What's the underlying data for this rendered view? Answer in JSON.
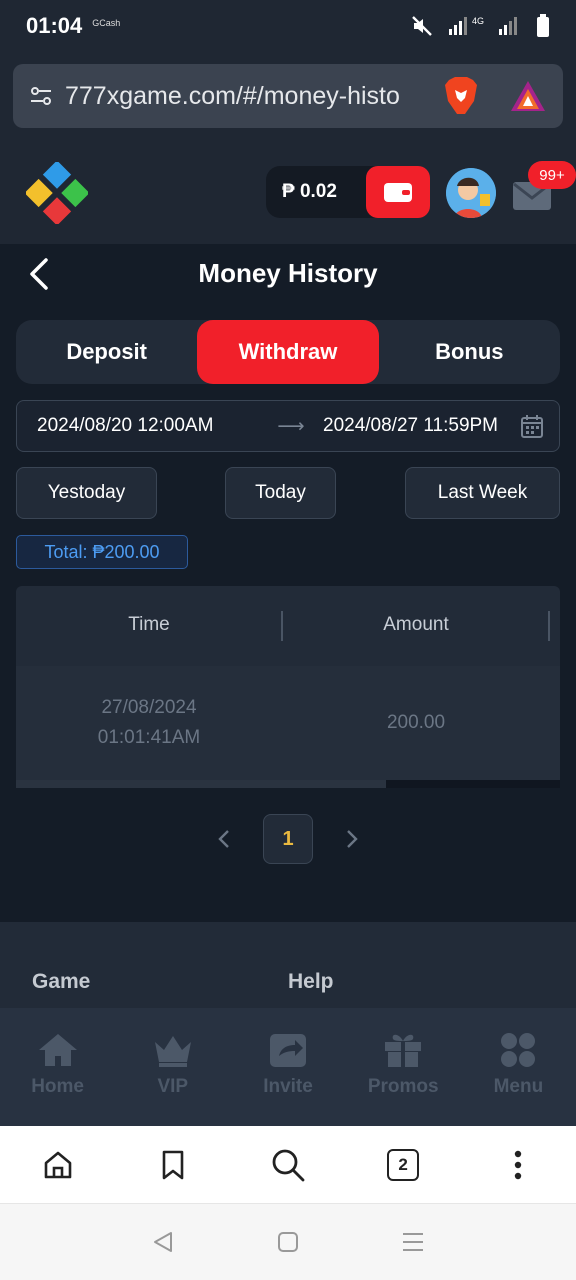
{
  "status_bar": {
    "time": "01:04",
    "app_label": "GCash",
    "network": "4G"
  },
  "browser": {
    "url": "777xgame.com/#/money-histo",
    "tab_count": "2"
  },
  "header": {
    "balance": "₱ 0.02",
    "mail_badge": "99+"
  },
  "page": {
    "title": "Money History"
  },
  "tabs": [
    {
      "label": "Deposit",
      "active": false
    },
    {
      "label": "Withdraw",
      "active": true
    },
    {
      "label": "Bonus",
      "active": false
    }
  ],
  "date_range": {
    "start": "2024/08/20 12:00AM",
    "arrow": "⟶",
    "end": "2024/08/27 11:59PM"
  },
  "quick_filters": [
    "Yestoday",
    "Today",
    "Last Week"
  ],
  "total": "Total: ₱200.00",
  "table": {
    "headers": [
      "Time",
      "Amount"
    ],
    "rows": [
      {
        "date": "27/08/2024",
        "time": "01:01:41AM",
        "amount": "200.00"
      }
    ]
  },
  "pagination": {
    "current": "1"
  },
  "footer": {
    "headings": [
      "Game",
      "Help"
    ]
  },
  "bottom_nav": [
    {
      "label": "Home",
      "icon": "home-icon"
    },
    {
      "label": "VIP",
      "icon": "crown-icon"
    },
    {
      "label": "Invite",
      "icon": "share-icon"
    },
    {
      "label": "Promos",
      "icon": "gift-icon"
    },
    {
      "label": "Menu",
      "icon": "menu-grid-icon"
    }
  ],
  "colors": {
    "accent": "#f1202a",
    "background": "#141c27",
    "panel": "#222b38",
    "total_blue": "#4d9cf2",
    "page_gold": "#e9b940"
  }
}
